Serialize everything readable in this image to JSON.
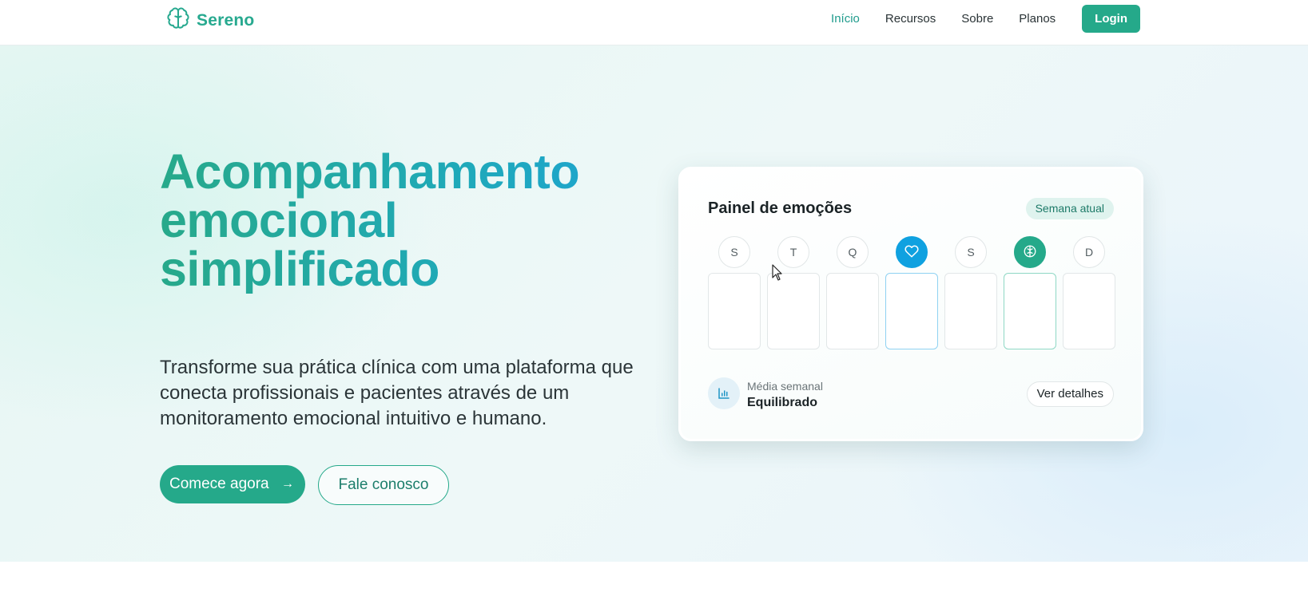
{
  "nav": {
    "brand": "Sereno",
    "links": [
      "Início",
      "Recursos",
      "Sobre",
      "Planos"
    ],
    "login": "Login"
  },
  "hero": {
    "title_lines": [
      "Acompanhamento",
      "emocional",
      "simplificado"
    ],
    "subtitle": "Transforme sua prática clínica com uma plataforma que conecta profissionais e pacientes através de um monitoramento emocional intuitivo e humano.",
    "primary_cta": "Comece agora",
    "secondary_cta": "Fale conosco"
  },
  "panel": {
    "title": "Painel de emoções",
    "badge": "Semana atual",
    "days": [
      {
        "label": "S",
        "icon": null
      },
      {
        "label": "T",
        "icon": null
      },
      {
        "label": "Q",
        "icon": null
      },
      {
        "label": "",
        "icon": "heart-icon"
      },
      {
        "label": "S",
        "icon": null
      },
      {
        "label": "",
        "icon": "brain-icon"
      },
      {
        "label": "D",
        "icon": null
      }
    ],
    "avg_label": "Média semanal",
    "avg_value": "Equilibrado",
    "details_button": "Ver detalhes"
  },
  "colors": {
    "brand_green": "#25a98a",
    "accent_blue": "#0fa1e0",
    "nav_active": "#1f9b8c"
  }
}
